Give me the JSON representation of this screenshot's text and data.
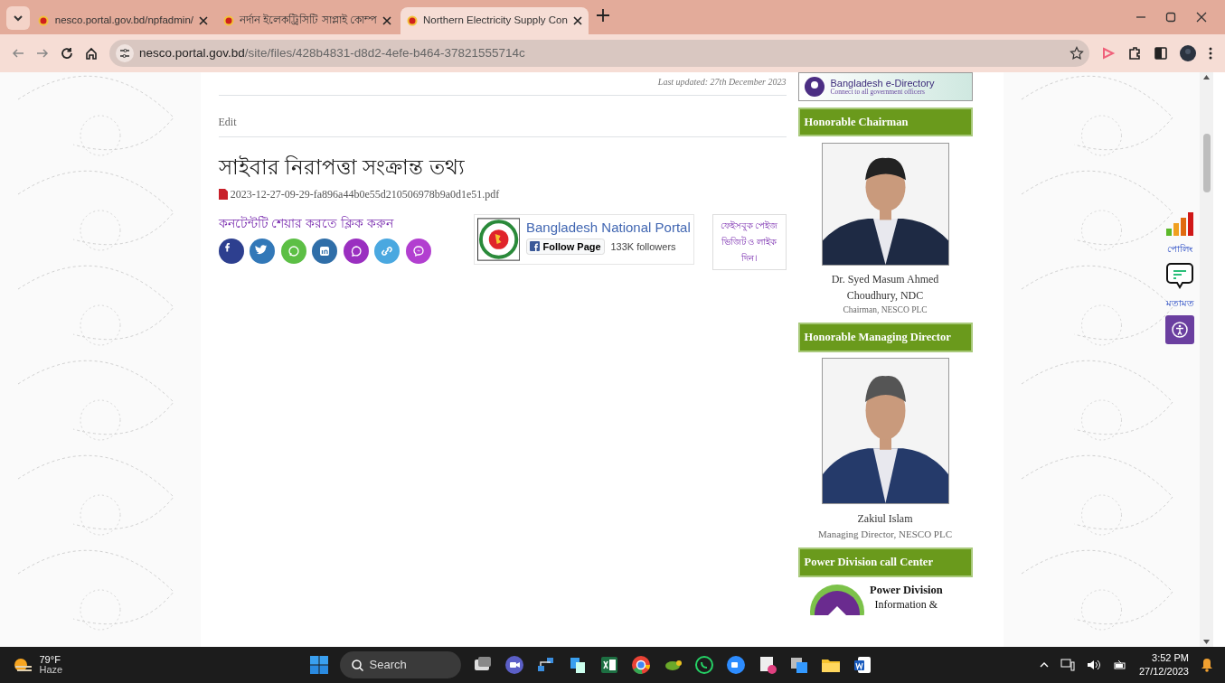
{
  "browser": {
    "tabs": [
      {
        "title": "nesco.portal.gov.bd/npfadmin/",
        "selected": false
      },
      {
        "title": "নর্দান ইলেকট্রিসিটি সাপ্লাই কোম্প",
        "selected": false
      },
      {
        "title": "Northern Electricity Supply Con",
        "selected": true
      }
    ],
    "address": {
      "host": "nesco.portal.gov.bd",
      "path": "/site/files/428b4831-d8d2-4efe-b464-37821555714c"
    }
  },
  "content": {
    "last_updated": "Last updated: 27th December 2023",
    "edit": "Edit",
    "title": "সাইবার নিরাপত্তা সংক্রান্ত তথ্য",
    "file": "2023-12-27-09-29-fa896a44b0e55d210506978b9a0d1e51.pdf",
    "share_label": "কনটেন্টটি শেয়ার করতে ক্লিক করুন",
    "share_buttons": [
      {
        "kind": "facebook",
        "color": "#2d3f8f"
      },
      {
        "kind": "twitter",
        "color": "#3278b8"
      },
      {
        "kind": "whatsapp",
        "color": "#5cbf45"
      },
      {
        "kind": "linkedin",
        "color": "#2f6ea8"
      },
      {
        "kind": "viber",
        "color": "#9a2fc0"
      },
      {
        "kind": "link",
        "color": "#4aa8e0"
      },
      {
        "kind": "messenger",
        "color": "#b23fd0"
      }
    ],
    "fb_widget": {
      "name": "Bangladesh National Portal",
      "follow": "Follow Page",
      "followers": "133K followers"
    },
    "fb_note": "ফেইসবুক পেইজ ভিজিট ও লাইক দিন।"
  },
  "sidebar": {
    "banner": {
      "title": "Bangladesh e-Directory",
      "subtitle": "Connect to all government officers"
    },
    "sections": [
      {
        "kind": "person",
        "heading": "Honorable Chairman",
        "name": "Dr. Syed Masum Ahmed Choudhury, NDC",
        "role": "Chairman, NESCO PLC"
      },
      {
        "kind": "person",
        "heading": "Honorable Managing Director",
        "name": "Zakiul Islam",
        "role": "Managing Director, NESCO PLC"
      },
      {
        "kind": "callcenter",
        "heading": "Power Division call Center",
        "lines": [
          "Power Division",
          "Information &"
        ]
      }
    ]
  },
  "floating": {
    "polling": "পোলিং",
    "feedback": "মতামত"
  },
  "taskbar": {
    "temperature": "79°F",
    "weather": "Haze",
    "search": "Search",
    "time": "3:52 PM",
    "date": "27/12/2023"
  }
}
